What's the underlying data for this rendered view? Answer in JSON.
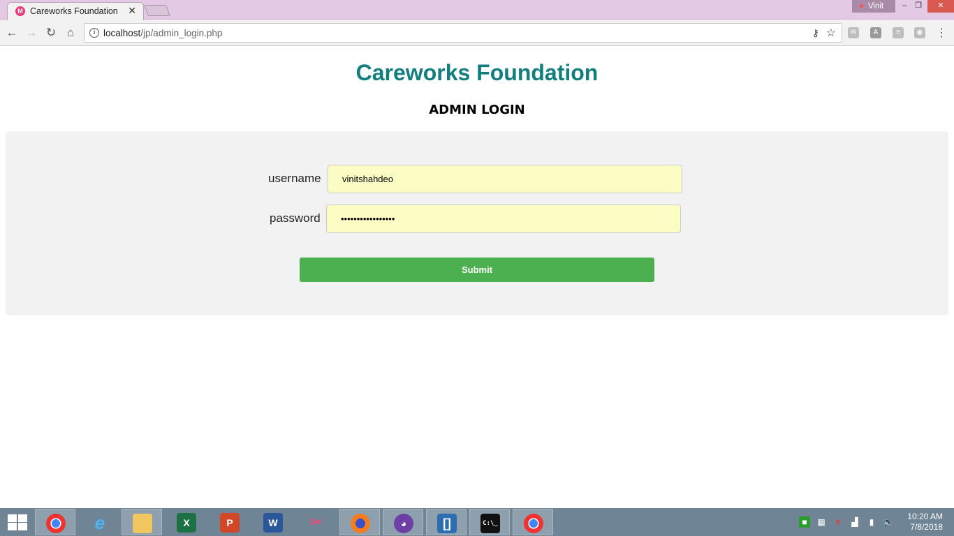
{
  "browser": {
    "tab_title": "Careworks Foundation",
    "tab_favicon_letter": "M",
    "profile_name": "Vinit",
    "url_host": "localhost",
    "url_path": "/jp/admin_login.php"
  },
  "page": {
    "title": "Careworks Foundation",
    "subtitle": "ADMIN LOGIN",
    "username_label": "username",
    "username_value": "vinitshahdeo",
    "password_label": "password",
    "password_value": "•••••••••••••••••",
    "submit_label": "Submit"
  },
  "taskbar": {
    "time": "10:20 AM",
    "date": "7/8/2018",
    "apps": [
      "chrome",
      "internet-explorer",
      "file-explorer",
      "excel",
      "powerpoint",
      "word",
      "snipping-tool",
      "firefox",
      "github-desktop",
      "brackets",
      "command-prompt",
      "chrome"
    ]
  },
  "colors": {
    "title": "#137e7e",
    "submit": "#4caf50",
    "field_bg": "#fbfdc4",
    "titlebar": "#e4c9e4"
  }
}
